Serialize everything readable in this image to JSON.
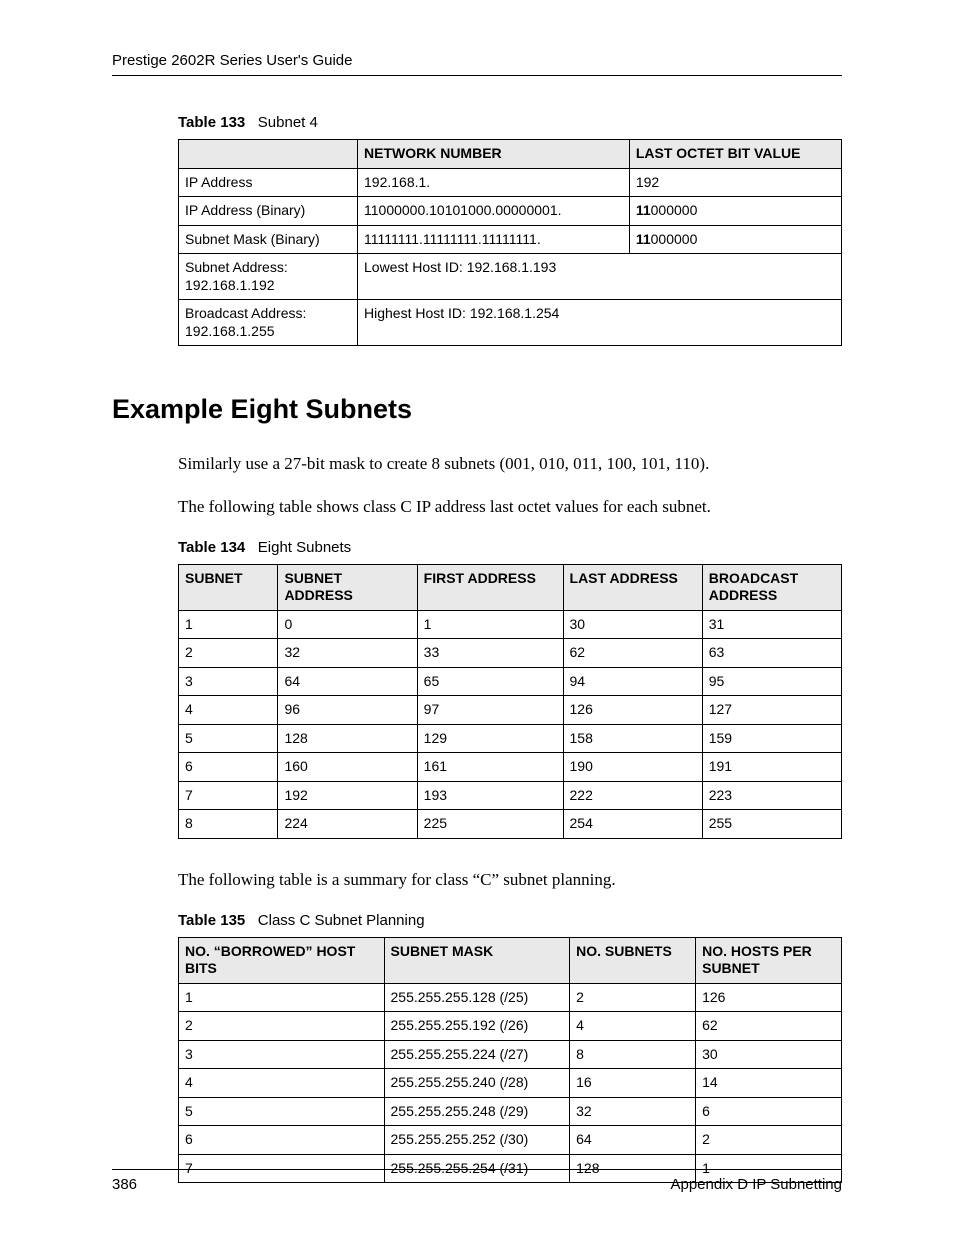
{
  "header": {
    "running_head": "Prestige 2602R Series User's Guide"
  },
  "table133": {
    "caption_num": "Table 133",
    "caption_title": "Subnet 4",
    "headers": [
      "",
      "NETWORK NUMBER",
      "LAST OCTET BIT VALUE"
    ],
    "rows": [
      {
        "label": "IP Address",
        "net": "192.168.1.",
        "last": "192"
      },
      {
        "label": "IP Address (Binary)",
        "net": "11000000.10101000.00000001.",
        "last_prefix": "11",
        "last_rest": "000000"
      },
      {
        "label": "Subnet Mask (Binary)",
        "net": "11111111.11111111.11111111.",
        "last_prefix": "11",
        "last_rest": "000000"
      },
      {
        "label_l1": "Subnet Address:",
        "label_l2": "192.168.1.192",
        "span": "Lowest Host ID: 192.168.1.193"
      },
      {
        "label_l1": "Broadcast Address:",
        "label_l2": "192.168.1.255",
        "span": "Highest Host ID: 192.168.1.254"
      }
    ]
  },
  "section": {
    "heading": "Example Eight Subnets",
    "para1": "Similarly use a 27-bit mask to create 8 subnets (001, 010, 011, 100, 101, 110).",
    "para2": "The following table shows class C IP address last octet values for each subnet.",
    "para3": "The following table is a summary for class “C” subnet planning."
  },
  "table134": {
    "caption_num": "Table 134",
    "caption_title": "Eight Subnets",
    "headers": [
      "SUBNET",
      "SUBNET ADDRESS",
      "FIRST ADDRESS",
      "LAST ADDRESS",
      "BROADCAST ADDRESS"
    ],
    "rows": [
      [
        "1",
        "0",
        "1",
        "30",
        "31"
      ],
      [
        "2",
        "32",
        "33",
        "62",
        "63"
      ],
      [
        "3",
        "64",
        "65",
        "94",
        "95"
      ],
      [
        "4",
        "96",
        "97",
        "126",
        "127"
      ],
      [
        "5",
        "128",
        "129",
        "158",
        "159"
      ],
      [
        "6",
        "160",
        "161",
        "190",
        "191"
      ],
      [
        "7",
        "192",
        "193",
        "222",
        "223"
      ],
      [
        "8",
        "224",
        "225",
        "254",
        "255"
      ]
    ]
  },
  "table135": {
    "caption_num": "Table 135",
    "caption_title": "Class C Subnet Planning",
    "headers": [
      "NO. “BORROWED” HOST BITS",
      "SUBNET MASK",
      "NO. SUBNETS",
      "NO. HOSTS PER SUBNET"
    ],
    "rows": [
      [
        "1",
        "255.255.255.128 (/25)",
        "2",
        "126"
      ],
      [
        "2",
        "255.255.255.192 (/26)",
        "4",
        "62"
      ],
      [
        "3",
        "255.255.255.224 (/27)",
        "8",
        "30"
      ],
      [
        "4",
        "255.255.255.240 (/28)",
        "16",
        "14"
      ],
      [
        "5",
        "255.255.255.248 (/29)",
        "32",
        "6"
      ],
      [
        "6",
        "255.255.255.252 (/30)",
        "64",
        "2"
      ],
      [
        "7",
        "255.255.255.254 (/31)",
        "128",
        "1"
      ]
    ]
  },
  "footer": {
    "page_number": "386",
    "section_ref": "Appendix D IP Subnetting"
  },
  "chart_data": [
    {
      "type": "table",
      "title": "Table 133  Subnet 4",
      "columns": [
        "",
        "NETWORK NUMBER",
        "LAST OCTET BIT VALUE"
      ],
      "rows": [
        [
          "IP Address",
          "192.168.1.",
          "192"
        ],
        [
          "IP Address (Binary)",
          "11000000.10101000.00000001.",
          "11000000"
        ],
        [
          "Subnet Mask (Binary)",
          "11111111.11111111.11111111.",
          "11000000"
        ],
        [
          "Subnet Address: 192.168.1.192",
          "Lowest Host ID: 192.168.1.193",
          ""
        ],
        [
          "Broadcast Address: 192.168.1.255",
          "Highest Host ID: 192.168.1.254",
          ""
        ]
      ]
    },
    {
      "type": "table",
      "title": "Table 134  Eight Subnets",
      "columns": [
        "SUBNET",
        "SUBNET ADDRESS",
        "FIRST ADDRESS",
        "LAST ADDRESS",
        "BROADCAST ADDRESS"
      ],
      "rows": [
        [
          1,
          0,
          1,
          30,
          31
        ],
        [
          2,
          32,
          33,
          62,
          63
        ],
        [
          3,
          64,
          65,
          94,
          95
        ],
        [
          4,
          96,
          97,
          126,
          127
        ],
        [
          5,
          128,
          129,
          158,
          159
        ],
        [
          6,
          160,
          161,
          190,
          191
        ],
        [
          7,
          192,
          193,
          222,
          223
        ],
        [
          8,
          224,
          225,
          254,
          255
        ]
      ]
    },
    {
      "type": "table",
      "title": "Table 135  Class C Subnet Planning",
      "columns": [
        "NO. “BORROWED” HOST BITS",
        "SUBNET MASK",
        "NO. SUBNETS",
        "NO. HOSTS PER SUBNET"
      ],
      "rows": [
        [
          1,
          "255.255.255.128 (/25)",
          2,
          126
        ],
        [
          2,
          "255.255.255.192 (/26)",
          4,
          62
        ],
        [
          3,
          "255.255.255.224 (/27)",
          8,
          30
        ],
        [
          4,
          "255.255.255.240 (/28)",
          16,
          14
        ],
        [
          5,
          "255.255.255.248 (/29)",
          32,
          6
        ],
        [
          6,
          "255.255.255.252 (/30)",
          64,
          2
        ],
        [
          7,
          "255.255.255.254 (/31)",
          128,
          1
        ]
      ]
    }
  ]
}
